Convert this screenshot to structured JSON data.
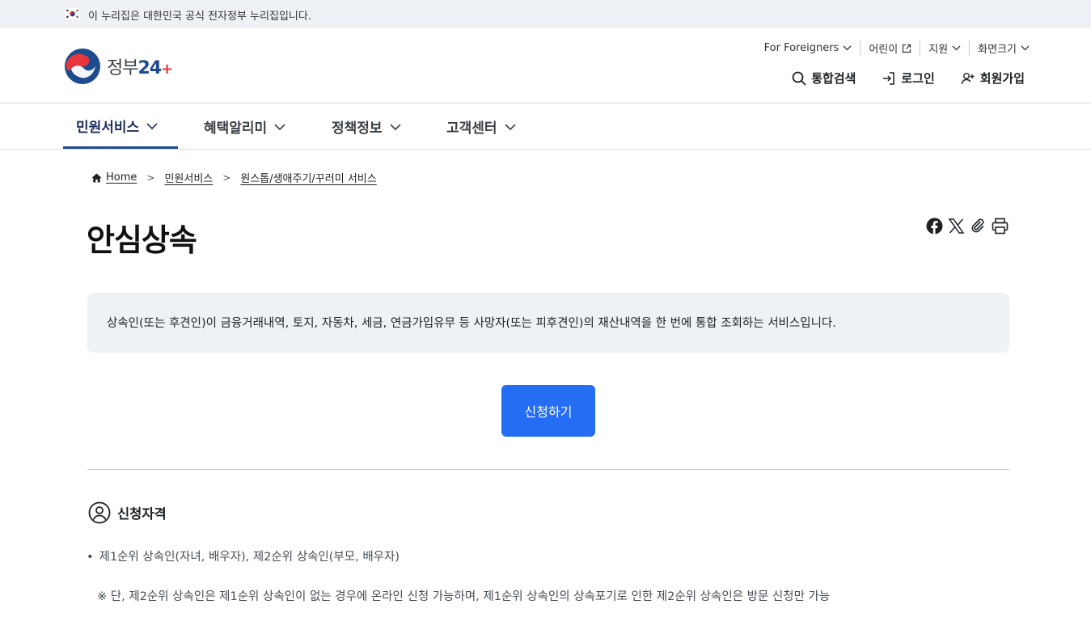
{
  "gov_banner": {
    "text": "이 누리집은 대한민국 공식 전자정부 누리집입니다."
  },
  "logo": {
    "text": "정부",
    "num": "24",
    "plus": "+"
  },
  "util_links": [
    {
      "label": "For Foreigners",
      "icon": "chevron-down-icon"
    },
    {
      "label": "어린이",
      "icon": "external-link-icon"
    },
    {
      "label": "지원",
      "icon": "chevron-down-icon"
    },
    {
      "label": "화면크기",
      "icon": "chevron-down-icon"
    }
  ],
  "header_actions": [
    {
      "label": "통합검색",
      "icon": "search-icon"
    },
    {
      "label": "로그인",
      "icon": "login-icon"
    },
    {
      "label": "회원가입",
      "icon": "user-add-icon"
    }
  ],
  "gnb": [
    {
      "label": "민원서비스",
      "active": true
    },
    {
      "label": "혜택알리미",
      "active": false
    },
    {
      "label": "정책정보",
      "active": false
    },
    {
      "label": "고객센터",
      "active": false
    }
  ],
  "breadcrumb": [
    "Home",
    "민원서비스",
    "원스톱/생애주기/꾸러미 서비스"
  ],
  "page": {
    "title": "안심상속",
    "description": "상속인(또는 후견인)이 금융거래내역, 토지, 자동차, 세금, 연금가입유무 등 사망자(또는 피후견인)의 재산내역을 한 번에 통합 조회하는 서비스입니다.",
    "apply_button": "신청하기"
  },
  "share_icons": [
    "facebook-icon",
    "x-icon",
    "link-icon",
    "print-icon"
  ],
  "eligibility": {
    "title": "신청자격",
    "bullet": "제1순위 상속인(자녀, 배우자), 제2순위 상속인(부모, 배우자)",
    "note": "※ 단, 제2순위 상속인은 제1순위 상속인이 없는 경우에 온라인 신청 가능하며, 제1순위 상속인의 상속포기로 인한 제2순위 상속인은 방문 신청만 가능"
  },
  "colors": {
    "primary": "#256ef4",
    "brand_navy": "#1d4c8e",
    "accent_red": "#e8363e",
    "panel_bg": "#eef1f5"
  }
}
